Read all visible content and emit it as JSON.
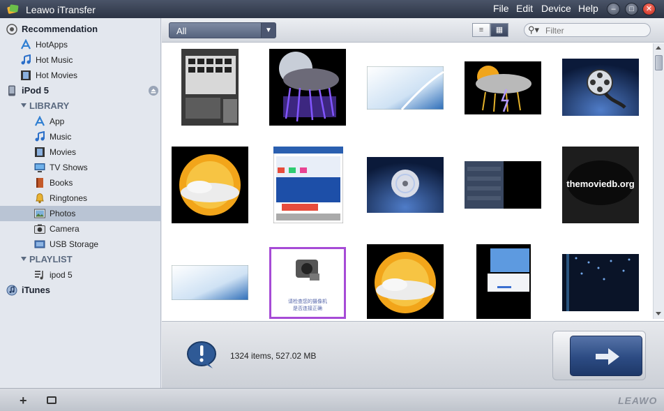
{
  "window": {
    "title": "Leawo iTransfer",
    "menus": [
      "File",
      "Edit",
      "Device",
      "Help"
    ],
    "controls": [
      "minimize-icon",
      "restore-icon",
      "close-icon"
    ]
  },
  "sidebar": {
    "recommendation": "Recommendation",
    "hotapps": "HotApps",
    "hotmusic": "Hot Music",
    "hotmovies": "Hot Movies",
    "device": "iPod 5",
    "library": "LIBRARY",
    "app": "App",
    "music": "Music",
    "movies": "Movies",
    "tvshows": "TV Shows",
    "books": "Books",
    "ringtones": "Ringtones",
    "photos": "Photos",
    "camera": "Camera",
    "usb": "USB Storage",
    "playlist": "PLAYLIST",
    "ipod5": "ipod 5",
    "itunes": "iTunes",
    "selected": "Photos"
  },
  "toolbar": {
    "filter": "All",
    "search_placeholder": "Filter",
    "view_mode": "grid"
  },
  "status": {
    "text": "1324 items, 527.02 MB"
  },
  "footer": {
    "brand": "LEAWO"
  },
  "thumbnails": {
    "texts": {
      "themoviedb": "themoviedb.org",
      "camera_caption_1": "请检查您的摄像机",
      "camera_caption_2": "是否连接正确"
    }
  },
  "colors": {
    "titlebar": "#2c3445",
    "selection": "#b9c4d4",
    "accent": "#2c4b83"
  }
}
